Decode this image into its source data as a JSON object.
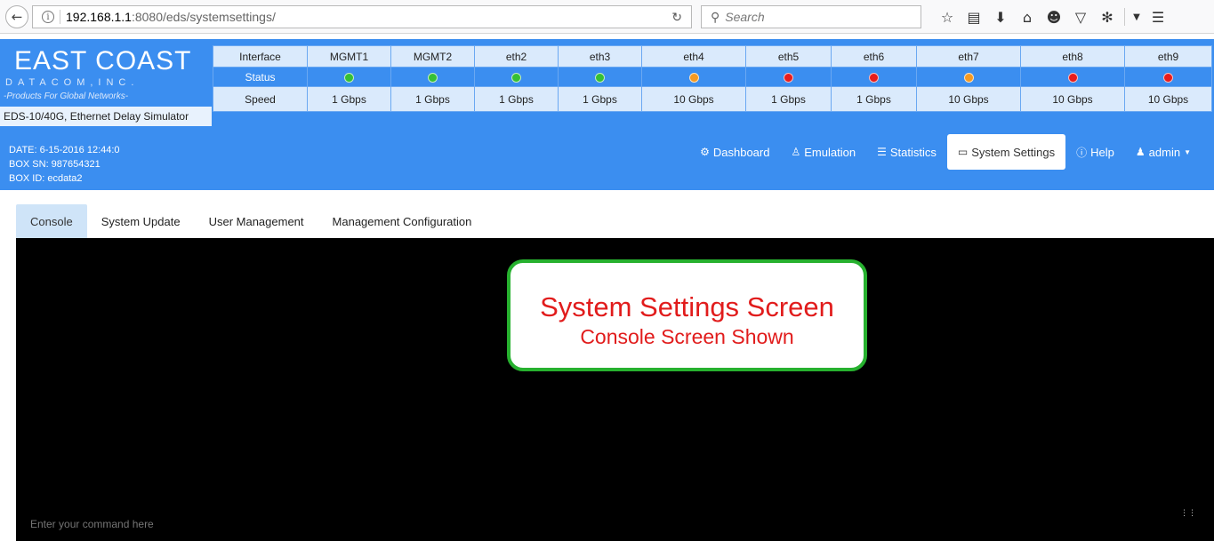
{
  "browser": {
    "url_host": "192.168.1.1",
    "url_path": ":8080/eds/systemsettings/",
    "search_placeholder": "Search"
  },
  "brand": {
    "name": "EAST COAST",
    "subname": "DATACOM,INC.",
    "tagline": "-Products For Global Networks-",
    "model": "EDS-10/40G, Ethernet Delay Simulator"
  },
  "interfaces": {
    "row_labels": {
      "interface": "Interface",
      "status": "Status",
      "speed": "Speed"
    },
    "items": [
      {
        "name": "MGMT1",
        "status": "green",
        "speed": "1 Gbps"
      },
      {
        "name": "MGMT2",
        "status": "green",
        "speed": "1 Gbps"
      },
      {
        "name": "eth2",
        "status": "green",
        "speed": "1 Gbps"
      },
      {
        "name": "eth3",
        "status": "green",
        "speed": "1 Gbps"
      },
      {
        "name": "eth4",
        "status": "orange",
        "speed": "10 Gbps"
      },
      {
        "name": "eth5",
        "status": "red",
        "speed": "1 Gbps"
      },
      {
        "name": "eth6",
        "status": "red",
        "speed": "1 Gbps"
      },
      {
        "name": "eth7",
        "status": "orange",
        "speed": "10 Gbps"
      },
      {
        "name": "eth8",
        "status": "red",
        "speed": "10 Gbps"
      },
      {
        "name": "eth9",
        "status": "red",
        "speed": "10 Gbps"
      }
    ]
  },
  "box": {
    "date": "DATE: 6-15-2016 12:44:0",
    "sn": "BOX SN: 987654321",
    "id": "BOX ID: ecdata2"
  },
  "nav": {
    "dashboard": "Dashboard",
    "emulation": "Emulation",
    "statistics": "Statistics",
    "system_settings": "System Settings",
    "help": "Help",
    "admin": "admin"
  },
  "tabs": {
    "console": "Console",
    "system_update": "System Update",
    "user_management": "User Management",
    "management_configuration": "Management Configuration"
  },
  "console": {
    "placeholder": "Enter your command here"
  },
  "callout": {
    "title": "System Settings Screen",
    "subtitle": "Console Screen Shown"
  },
  "colors": {
    "header": "#3b8ef0",
    "green": "#35c035",
    "orange": "#f59a23",
    "red": "#e81c1c"
  }
}
